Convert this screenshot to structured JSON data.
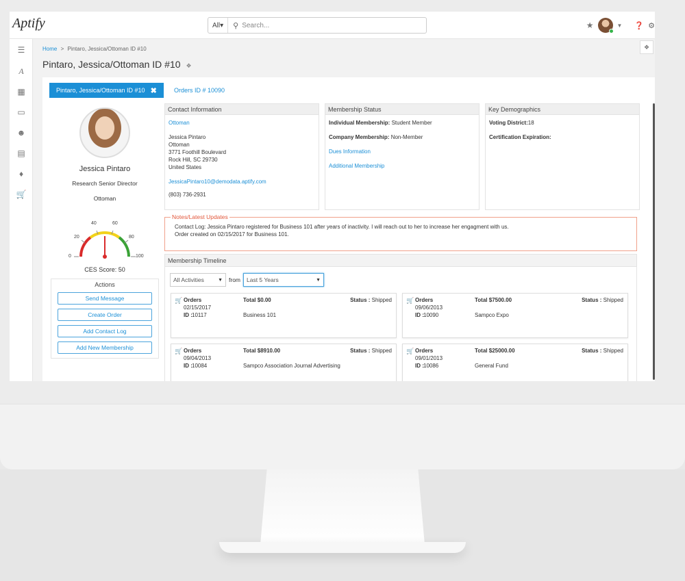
{
  "app": {
    "logo_text": "Aptify"
  },
  "search": {
    "scope": "All▾",
    "placeholder": "Search..."
  },
  "breadcrumb": {
    "home": "Home",
    "separator": ">",
    "current": "Pintaro, Jessica/Ottoman ID #10"
  },
  "page_title": "Pintaro, Jessica/Ottoman ID #10",
  "tabs": [
    {
      "label": "Pintaro, Jessica/Ottoman ID #10",
      "active": true
    },
    {
      "label": "Orders ID # 10090",
      "active": false
    }
  ],
  "profile": {
    "name": "Jessica Pintaro",
    "title": "Research Senior Director",
    "company": "Ottoman",
    "gauge_ticks": [
      "0",
      "20",
      "40",
      "60",
      "80",
      "100"
    ],
    "ces_score_text": "CES Score: 50",
    "ces_score_value": 50
  },
  "actions": {
    "title": "Actions",
    "buttons": [
      "Send Message",
      "Create Order",
      "Add Contact Log",
      "Add New Membership"
    ]
  },
  "contact": {
    "heading": "Contact Information",
    "company_link": "Ottoman",
    "name": "Jessica Pintaro",
    "company": "Ottoman",
    "street": "3771 Foothill Boulevard",
    "city": "Rock Hill, SC 29730",
    "country": "United States",
    "email": "JessicaPintaro10@demodata.aptify.com",
    "phone": "(803) 736-2931"
  },
  "membership": {
    "heading": "Membership Status",
    "individual_label": "Individual Membership:",
    "individual_value": "Student Member",
    "company_label": "Company Membership:",
    "company_value": "Non-Member",
    "dues_link": "Dues Information",
    "additional_link": "Additional Membership"
  },
  "demographics": {
    "heading": "Key Demographics",
    "voting_label": "Voting District:",
    "voting_value": "18",
    "cert_label": "Certification Expiration:"
  },
  "notes": {
    "legend": "Notes/Latest Updates",
    "line1": "Contact Log: Jessica Pintaro registered for Business 101 after years of inactivity. I will reach out to her to increase her engagment with us.",
    "line2": "Order created on 02/15/2017 for Business 101."
  },
  "timeline": {
    "heading": "Membership Timeline",
    "activity_filter": "All Activities",
    "from_label": "from",
    "range_filter": "Last 5 Years",
    "orders": [
      {
        "label": "Orders",
        "date": "02/15/2017",
        "id_label": "ID :",
        "id": "10117",
        "total": "Total $0.00",
        "product": "Business 101",
        "status_label": "Status :",
        "status": "Shipped"
      },
      {
        "label": "Orders",
        "date": "09/06/2013",
        "id_label": "ID :",
        "id": "10090",
        "total": "Total $7500.00",
        "product": "Sampco Expo",
        "status_label": "Status :",
        "status": "Shipped"
      },
      {
        "label": "Orders",
        "date": "09/04/2013",
        "id_label": "ID :",
        "id": "10084",
        "total": "Total $8910.00",
        "product": "Sampco Association Journal Advertising",
        "status_label": "Status :",
        "status": "Shipped"
      },
      {
        "label": "Orders",
        "date": "09/01/2013",
        "id_label": "ID :",
        "id": "10086",
        "total": "Total $25000.00",
        "product": "General Fund",
        "status_label": "Status :",
        "status": "Shipped"
      }
    ]
  },
  "colors": {
    "accent": "#1b8fd6",
    "notes_border": "#f0a08a",
    "notes_legend": "#e2573b",
    "cart": "#d9262a"
  },
  "icons": [
    "menu-icon",
    "aptify-mark-icon",
    "calculator-icon",
    "monitor-icon",
    "people-icon",
    "calendar-icon",
    "diamond-icon",
    "cart-icon",
    "star-icon",
    "help-icon",
    "settings-icon",
    "search-icon",
    "pin-icon"
  ]
}
